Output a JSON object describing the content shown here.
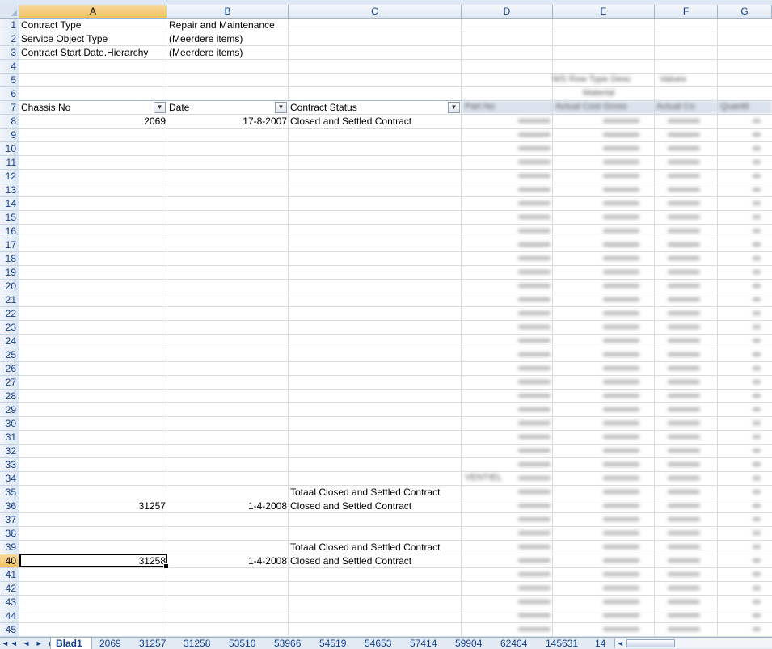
{
  "columns": [
    "A",
    "B",
    "C",
    "D",
    "E",
    "F",
    "G"
  ],
  "selected_column": "A",
  "rows": [
    "1",
    "2",
    "3",
    "4",
    "5",
    "6",
    "7",
    "8",
    "9",
    "10",
    "11",
    "12",
    "13",
    "14",
    "15",
    "16",
    "17",
    "18",
    "19",
    "20",
    "21",
    "22",
    "23",
    "24",
    "25",
    "26",
    "27",
    "28",
    "29",
    "30",
    "31",
    "32",
    "33",
    "34",
    "35",
    "36",
    "37",
    "38",
    "39",
    "40",
    "41",
    "42",
    "43",
    "44",
    "45"
  ],
  "selected_row": "40",
  "filters": {
    "r1_label": "Contract Type",
    "r1_value": "Repair and Maintenance",
    "r2_label": "Service Object Type",
    "r2_value": "(Meerdere items)",
    "r3_label": "Contract Start Date.Hierarchy",
    "r3_value": "(Meerdere items)"
  },
  "pivot_headers": {
    "chassis": "Chassis No",
    "date": "Date",
    "status": "Contract Status"
  },
  "cells": {
    "a8": "2069",
    "b8": "17-8-2007",
    "c8": "Closed and Settled Contract",
    "c35": "Totaal Closed and Settled Contract",
    "a36": "31257",
    "b36": "1-4-2008",
    "c36": "Closed and Settled Contract",
    "c39": "Totaal Closed and Settled Contract",
    "a40": "31258",
    "b40": "1-4-2008",
    "c40": "Closed and Settled Contract"
  },
  "blurred": {
    "h5a": "WS Row Type Desc",
    "h5b": "Values",
    "h6": "Material",
    "h7a": "Part No",
    "h7b": "Actual Cost Gross",
    "h7c": "Actual Co",
    "h7d": "Quantit",
    "v34": "VENTIEL"
  },
  "sheet_tabs": [
    "Blad1",
    "2069",
    "31257",
    "31258",
    "53510",
    "53966",
    "54519",
    "54653",
    "57414",
    "59904",
    "62404",
    "145631",
    "14"
  ],
  "active_tab": "Blad1",
  "tab_nav": "◄◄ ◄ ► ►|",
  "dropdown_glyph": "▼"
}
